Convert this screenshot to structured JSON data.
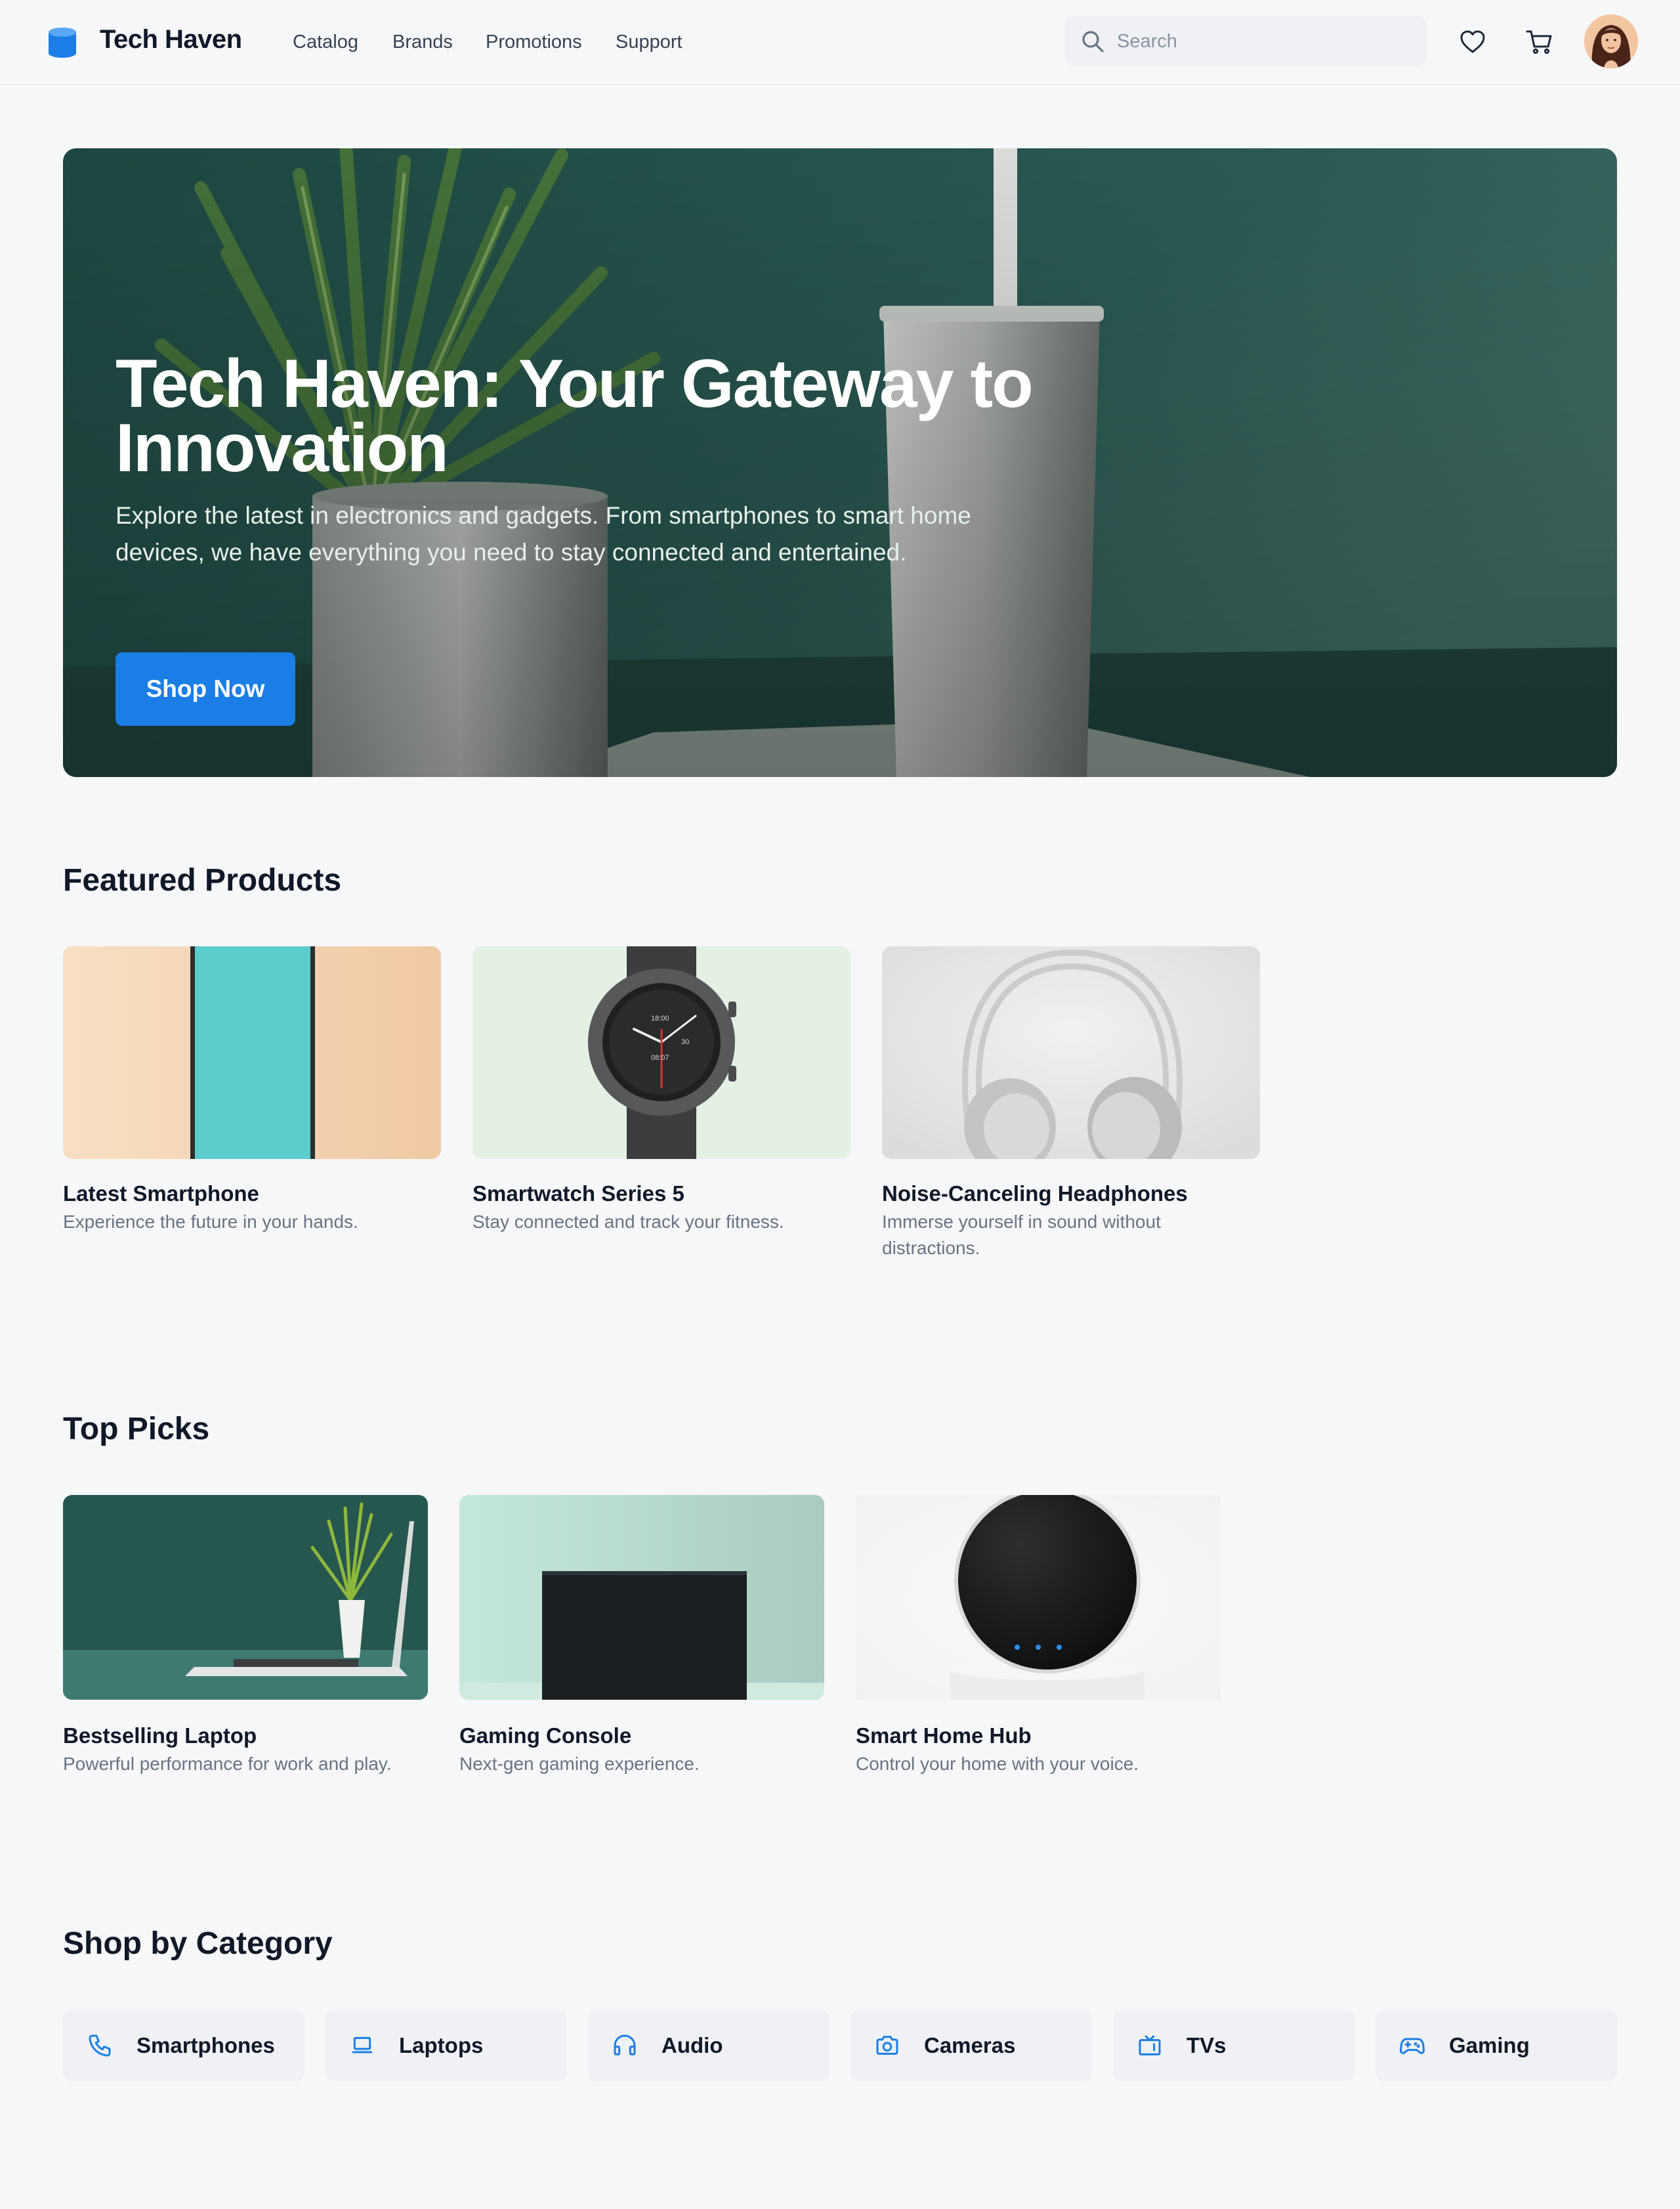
{
  "header": {
    "brand": "Tech Haven",
    "nav": [
      "Catalog",
      "Brands",
      "Promotions",
      "Support"
    ],
    "search_placeholder": "Search",
    "icons": [
      "database-logo-icon",
      "search-icon",
      "heart-icon",
      "cart-icon"
    ]
  },
  "hero": {
    "title": "Tech Haven: Your Gateway to Innovation",
    "subtitle": "Explore the latest in electronics and gadgets. From smartphones to smart home devices, we have everything you need to stay connected and entertained.",
    "cta": "Shop Now"
  },
  "featured": {
    "title": "Featured Products",
    "items": [
      {
        "title": "Latest Smartphone",
        "desc": "Experience the future in your hands."
      },
      {
        "title": "Smartwatch Series 5",
        "desc": "Stay connected and track your fitness.",
        "watch_face": [
          "18:00",
          "30",
          "08:07"
        ]
      },
      {
        "title": "Noise-Canceling Headphones",
        "desc": "Immerse yourself in sound without distractions."
      }
    ]
  },
  "top_picks": {
    "title": "Top Picks",
    "items": [
      {
        "title": "Bestselling Laptop",
        "desc": "Powerful performance for work and play."
      },
      {
        "title": "Gaming Console",
        "desc": "Next-gen gaming experience."
      },
      {
        "title": "Smart Home Hub",
        "desc": "Control your home with your voice."
      }
    ]
  },
  "categories": {
    "title": "Shop by Category",
    "items": [
      {
        "label": "Smartphones",
        "icon": "phone-icon"
      },
      {
        "label": "Laptops",
        "icon": "laptop-icon"
      },
      {
        "label": "Audio",
        "icon": "headphones-icon"
      },
      {
        "label": "Cameras",
        "icon": "camera-icon"
      },
      {
        "label": "TVs",
        "icon": "tv-icon"
      },
      {
        "label": "Gaming",
        "icon": "gamepad-icon"
      }
    ]
  },
  "colors": {
    "accent": "#1a7ee6",
    "background": "#f6f7f9",
    "text": "#111827",
    "muted": "#6b7280",
    "chip": "#eff1f4"
  }
}
